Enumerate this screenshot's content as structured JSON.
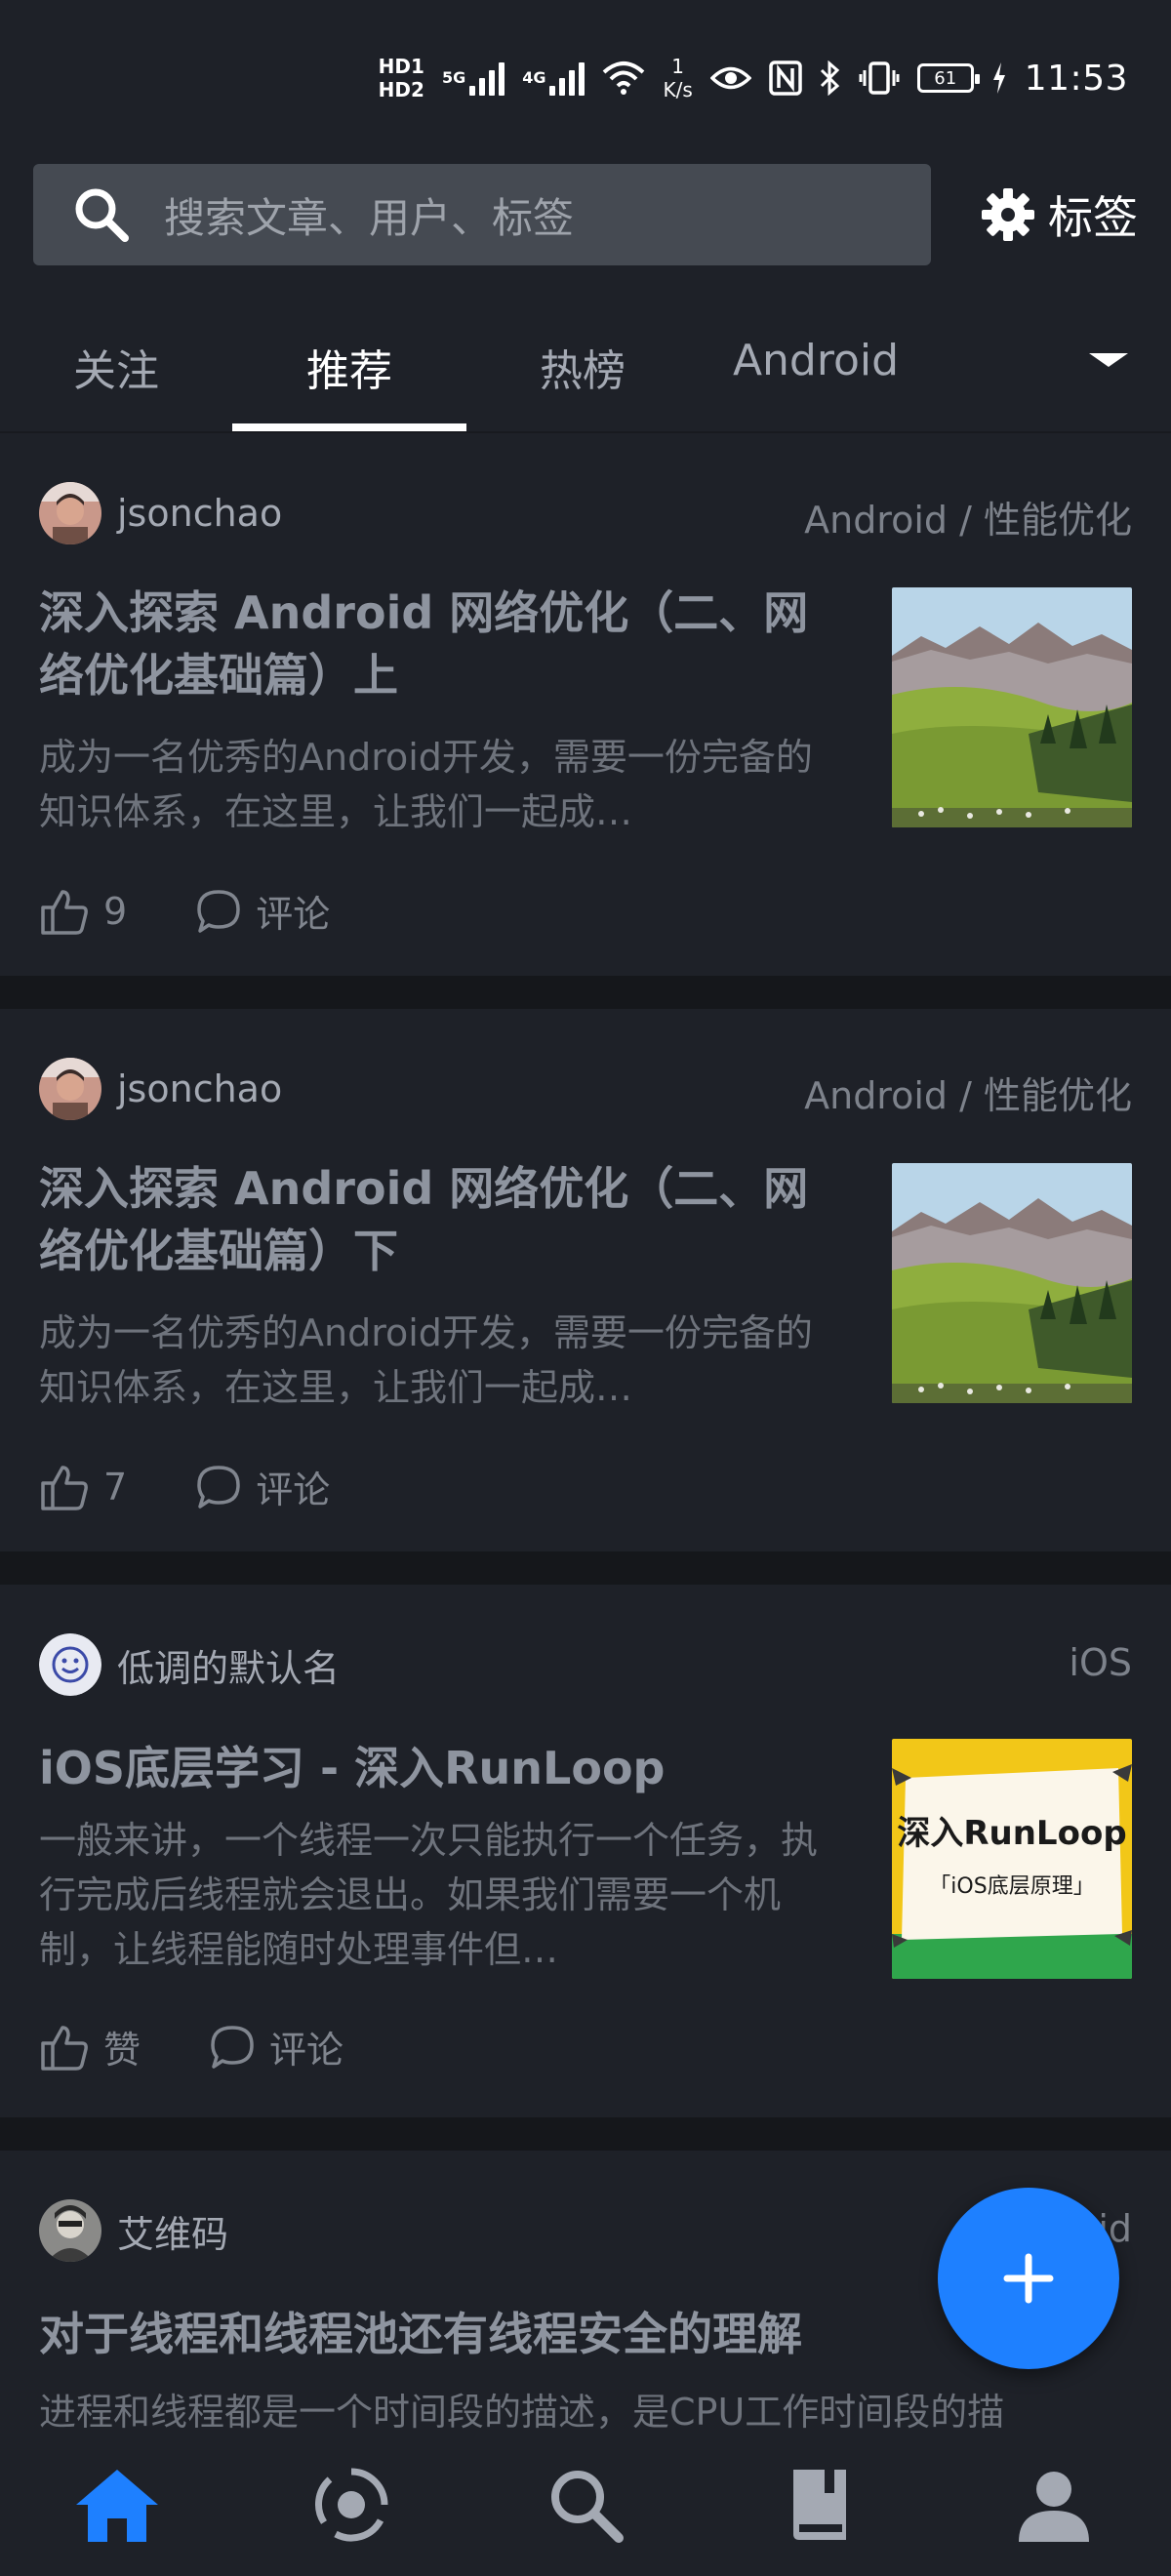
{
  "status_bar": {
    "hd1": "HD1",
    "hd2": "HD2",
    "net1": "5G",
    "net2": "4G",
    "speed_value": "1",
    "speed_unit": "K/s",
    "battery": "61",
    "time": "11:53"
  },
  "search": {
    "placeholder": "搜索文章、用户、标签",
    "tags_label": "标签"
  },
  "tabs": [
    {
      "label": "关注"
    },
    {
      "label": "推荐"
    },
    {
      "label": "热榜"
    },
    {
      "label": "Android"
    }
  ],
  "active_tab": "推荐",
  "articles": [
    {
      "author": "jsonchao",
      "category": "Android / 性能优化",
      "title": "深入探索 Android 网络优化（二、网络优化基础篇）上",
      "summary": "成为一名优秀的Android开发，需要一份完备的知识体系，在这里，让我们一起成…",
      "likes": "9",
      "comment_label": "评论"
    },
    {
      "author": "jsonchao",
      "category": "Android / 性能优化",
      "title": "深入探索 Android 网络优化（二、网络优化基础篇）下",
      "summary": "成为一名优秀的Android开发，需要一份完备的知识体系，在这里，让我们一起成…",
      "likes": "7",
      "comment_label": "评论"
    },
    {
      "author": "低调的默认名",
      "category": "iOS",
      "title": "iOS底层学习 - 深入RunLoop",
      "summary": "一般来讲，一个线程一次只能执行一个任务，执行完成后线程就会退出。如果我们需要一个机制，让线程能随时处理事件但…",
      "likes": "赞",
      "comment_label": "评论",
      "thumb_title": "深入RunLoop",
      "thumb_subtitle": "「iOS底层原理」"
    },
    {
      "author": "艾维码",
      "category": "id",
      "title": "对于线程和线程池还有线程安全的理解",
      "summary": "进程和线程都是一个时间段的描述，是CPU工作时间段的描"
    }
  ],
  "fab_label": "+",
  "bottom_nav": [
    {
      "icon": "home-icon",
      "active": true
    },
    {
      "icon": "pins-icon"
    },
    {
      "icon": "discover-icon"
    },
    {
      "icon": "book-icon"
    },
    {
      "icon": "profile-icon"
    }
  ],
  "colors": {
    "background": "#1e2128",
    "separator": "#15171b",
    "accent": "#1e80ff",
    "search_box": "#454a52"
  }
}
